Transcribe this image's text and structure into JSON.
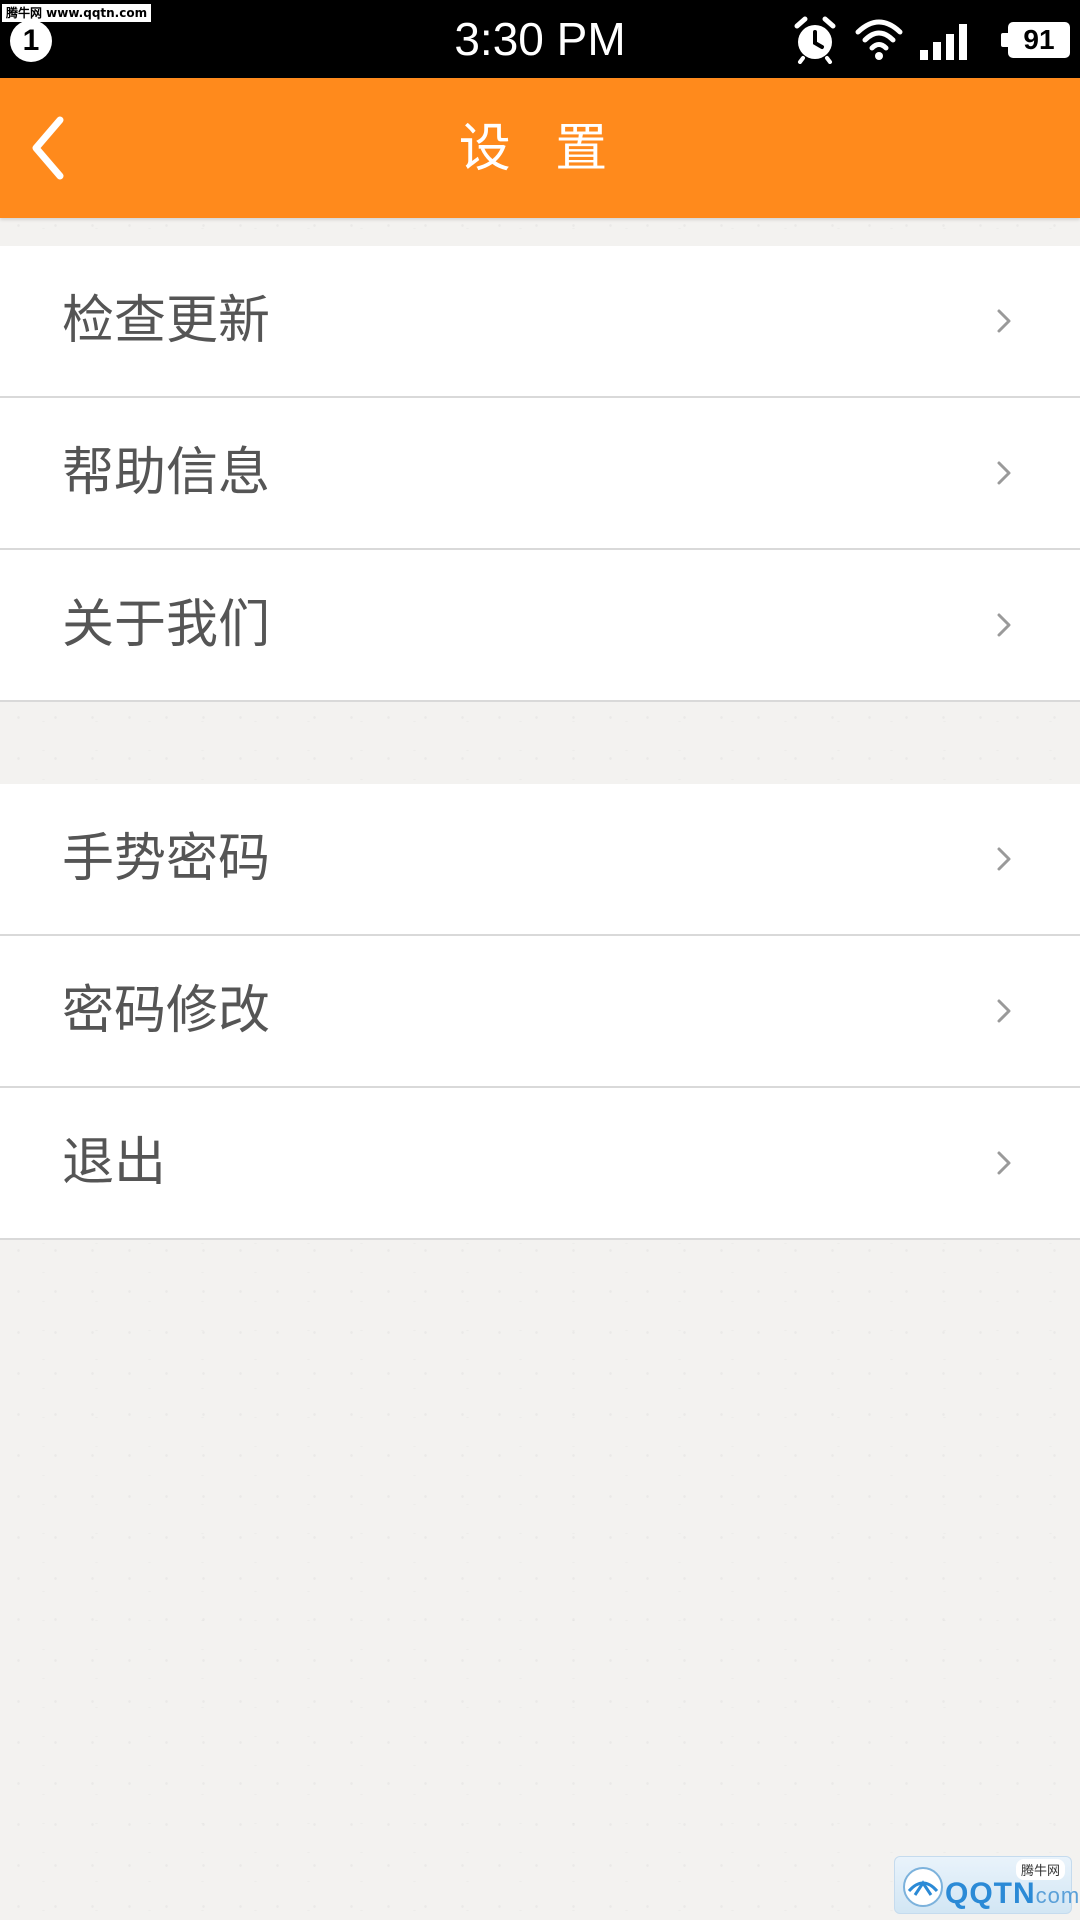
{
  "status_bar": {
    "watermark": "腾牛网 www.qqtn.com",
    "notification_count": "1",
    "time": "3:30 PM",
    "battery": "91",
    "icons": [
      "alarm-icon",
      "wifi-icon",
      "signal-icon",
      "battery-icon"
    ]
  },
  "header": {
    "title": "设 置",
    "back_icon": "chevron-left-icon",
    "background_color": "#ff8a1c"
  },
  "groups": [
    {
      "items": [
        {
          "label": "检查更新",
          "icon": "chevron-right-icon"
        },
        {
          "label": "帮助信息",
          "icon": "chevron-right-icon"
        },
        {
          "label": "关于我们",
          "icon": "chevron-right-icon"
        }
      ]
    },
    {
      "items": [
        {
          "label": "手势密码",
          "icon": "chevron-right-icon"
        },
        {
          "label": "密码修改",
          "icon": "chevron-right-icon"
        },
        {
          "label": "退出",
          "icon": "chevron-right-icon"
        }
      ]
    }
  ],
  "watermark_bottom": {
    "tag": "腾牛网",
    "brand": "QQTN",
    "suffix": "com"
  }
}
